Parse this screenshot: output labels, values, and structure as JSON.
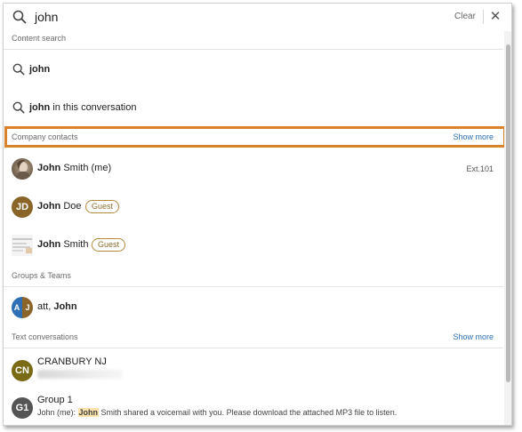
{
  "search": {
    "value": "john",
    "clear_label": "Clear",
    "close_glyph": "✕"
  },
  "content_search": {
    "header": "Content search",
    "query": "john",
    "query_in_conv_bold": "john",
    "query_in_conv_rest": " in this conversation"
  },
  "company_contacts": {
    "header": "Company contacts",
    "show_more": "Show more",
    "items": [
      {
        "first": "John",
        "last": " Smith (me)",
        "ext": "Ext.101",
        "avatar": "photo"
      },
      {
        "first": "John",
        "last": " Doe",
        "badge": "Guest",
        "initials": "JD",
        "avatar_color": "#8a6428"
      },
      {
        "first": "John",
        "last": " Smith",
        "badge": "Guest",
        "avatar": "image"
      }
    ]
  },
  "groups_teams": {
    "header": "Groups & Teams",
    "items": [
      {
        "name_prefix": "att, ",
        "name_bold": "John",
        "left_initial": "A",
        "right_initial": "J",
        "left_color": "#2e6fb5",
        "right_color": "#8a6428"
      }
    ]
  },
  "text_conversations": {
    "header": "Text conversations",
    "show_more": "Show more",
    "items": [
      {
        "title": "CRANBURY NJ",
        "initials": "CN",
        "avatar_color": "#7a6a15"
      },
      {
        "title": "Group 1",
        "initials": "G1",
        "avatar_color": "#555555",
        "sub_prefix": "John (me): ",
        "sub_highlight": "John",
        "sub_rest": " Smith shared a voicemail with you. Please download the attached MP3 file to listen."
      }
    ]
  },
  "colors": {
    "accent_link": "#2a6fb5",
    "highlight_border": "#d9822b",
    "guest_badge": "#b38a3a"
  }
}
